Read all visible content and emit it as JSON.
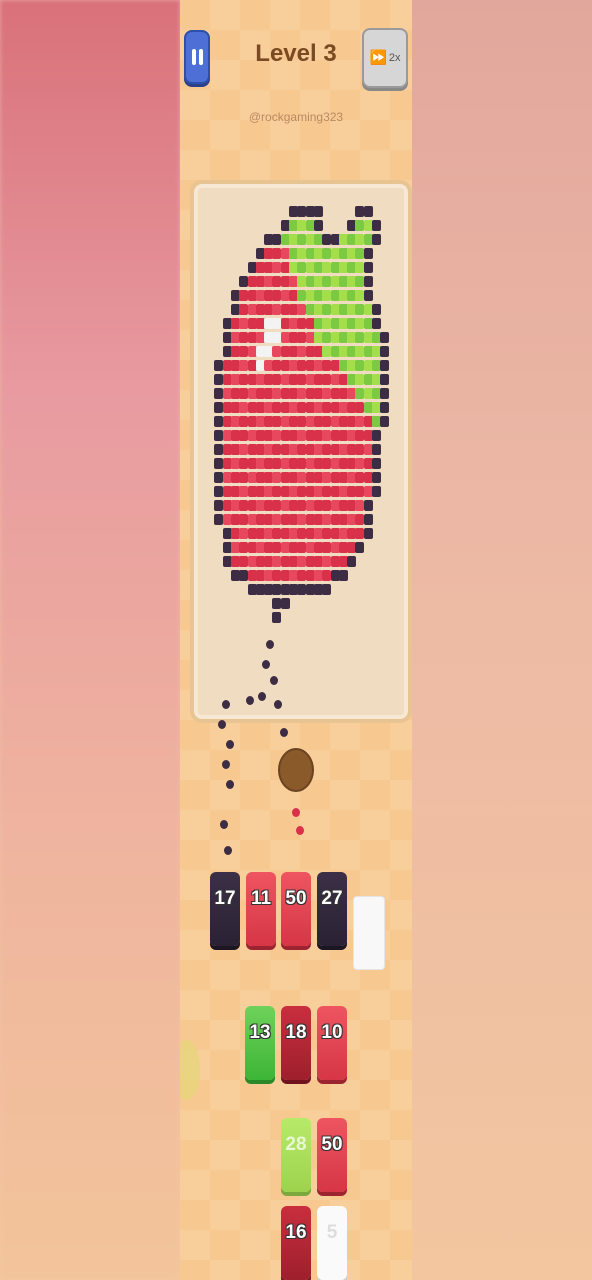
{
  "header": {
    "level_title": "Level 3",
    "username": "@rockgaming323",
    "speed_label": "2x"
  },
  "queue_slots": [
    {
      "value": "17",
      "color": "dark"
    },
    {
      "value": "11",
      "color": "red"
    },
    {
      "value": "50",
      "color": "red"
    },
    {
      "value": "27",
      "color": "dark"
    }
  ],
  "grid": {
    "col1": [
      {
        "value": "13",
        "color": "green"
      }
    ],
    "col2": [
      {
        "value": "18",
        "color": "crimson"
      },
      {
        "value": "28",
        "color": "lgreen"
      },
      {
        "value": "16",
        "color": "crimson"
      }
    ],
    "col3": [
      {
        "value": "10",
        "color": "red"
      },
      {
        "value": "50",
        "color": "red"
      },
      {
        "value": "5",
        "color": "white"
      }
    ]
  },
  "colors": {
    "pause": "#4d6fd6",
    "title": "#7a4a23",
    "board": "#f0dcc0",
    "apple_red": "#d9314a",
    "leaf_green": "#7cc942",
    "outline_dark": "#3d2d44"
  }
}
